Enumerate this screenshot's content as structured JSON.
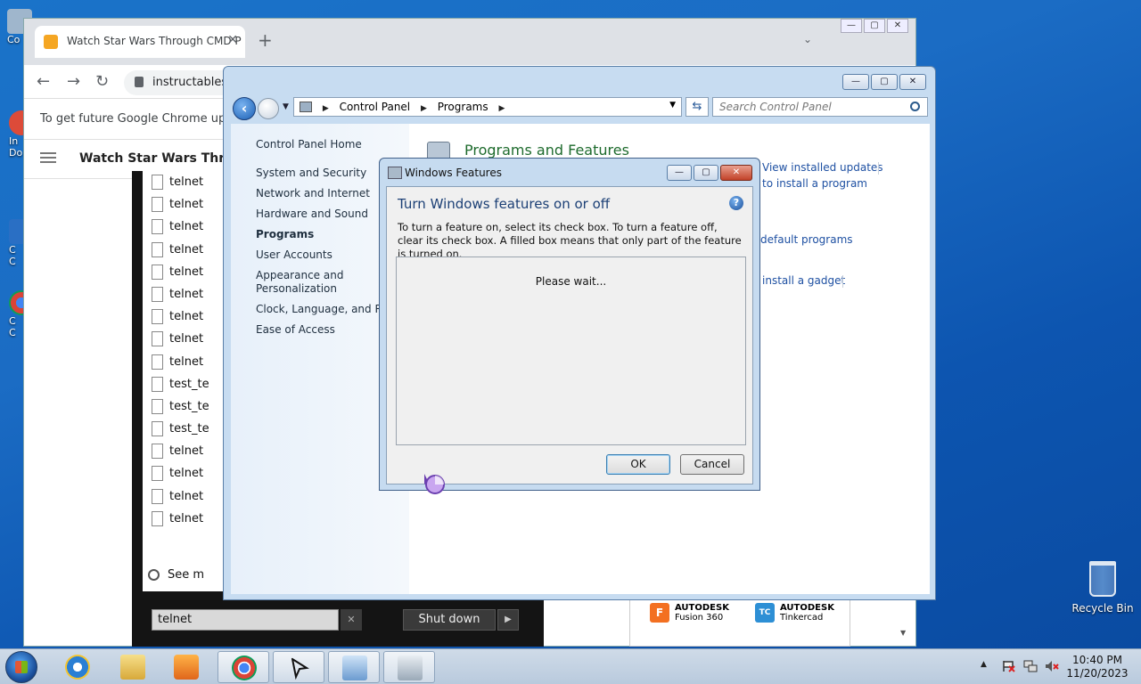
{
  "desktop": {
    "left_icons": [
      {
        "label": "Co"
      },
      {
        "label": "In"
      },
      {
        "label": "Do"
      },
      {
        "label": "C"
      },
      {
        "label": "C"
      },
      {
        "label": "C"
      },
      {
        "label": "C"
      }
    ],
    "recycle_bin": {
      "label": "Recycle Bin"
    }
  },
  "chrome": {
    "tab": {
      "title": "Watch Star Wars Through CMD P",
      "close": "✕"
    },
    "new_tab": "+",
    "tab_menu": "⌄",
    "window_buttons": {
      "minimize": "—",
      "maximize": "▢",
      "close": "✕"
    },
    "toolbar": {
      "back": "←",
      "forward": "→",
      "reload": "↻",
      "url": "instructables"
    },
    "infobar": {
      "text": "To get future Google Chrome updat"
    },
    "site_header": {
      "title": "Watch Star Wars Throug"
    }
  },
  "start_menu": {
    "results": [
      "telnet",
      "telnet",
      "telnet",
      "telnet",
      "telnet",
      "telnet",
      "telnet",
      "telnet",
      "telnet",
      "test_te",
      "test_te",
      "test_te",
      "telnet",
      "telnet",
      "telnet",
      "telnet"
    ],
    "see_more": "See m",
    "search_value": "telnet",
    "clear": "✕",
    "shut_down": "Shut down",
    "shut_down_arrow": "▶"
  },
  "ad": {
    "items": [
      {
        "brand": "AUTODESK",
        "product": "Fusion 360",
        "badge": "F",
        "color": "#f37021"
      },
      {
        "brand": "AUTODESK",
        "product": "Tinkercad",
        "badge": "TC",
        "color": "#2d8fd5"
      }
    ],
    "scroll_arrow": "▼"
  },
  "control_panel": {
    "window_buttons": {
      "minimize": "—",
      "maximize": "▢",
      "close": "✕"
    },
    "address": {
      "crumbs": [
        "Control Panel",
        "Programs"
      ],
      "sep": "▶",
      "dropdown": "▼"
    },
    "refresh": "⇆",
    "search_placeholder": "Search Control Panel",
    "home": "Control Panel Home",
    "nav": [
      {
        "label": "System and Security"
      },
      {
        "label": "Network and Internet"
      },
      {
        "label": "Hardware and Sound"
      },
      {
        "label": "Programs",
        "current": true
      },
      {
        "label": "User Accounts"
      },
      {
        "label": "Appearance and Personalization"
      },
      {
        "label": "Clock, Language, and Reg"
      },
      {
        "label": "Ease of Access"
      }
    ],
    "main": {
      "title": "Programs and Features",
      "links": {
        "view_updates": "View installed updates",
        "install_program": "to install a program",
        "default_programs": "default programs",
        "install_gadget": "install a gadget"
      }
    }
  },
  "windows_features": {
    "title": "Windows Features",
    "buttons": {
      "minimize": "—",
      "maximize": "▢",
      "close": "✕"
    },
    "heading": "Turn Windows features on or off",
    "help": "?",
    "description": "To turn a feature on, select its check box. To turn a feature off, clear its check box. A filled box means that only part of the feature is turned on.",
    "status": "Please wait...",
    "ok": "OK",
    "cancel": "Cancel"
  },
  "taskbar": {
    "tray_arrow": "▲",
    "time": "10:40 PM",
    "date": "11/20/2023"
  }
}
